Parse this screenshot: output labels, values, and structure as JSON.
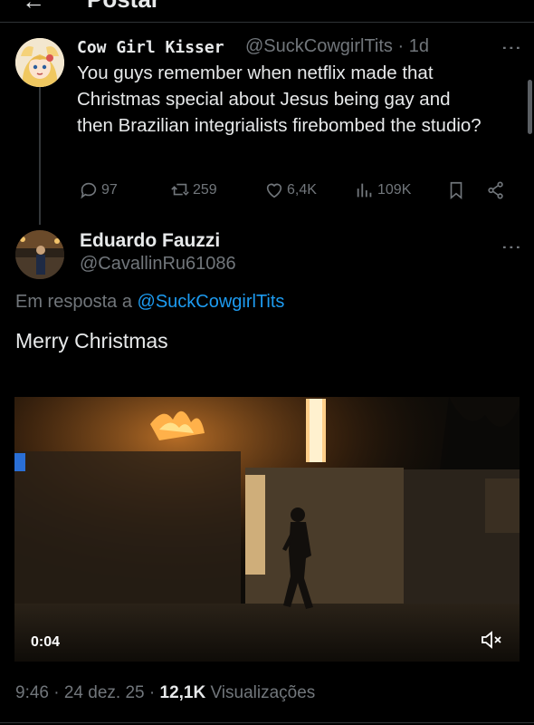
{
  "header": {
    "back_icon": "arrow-left-icon",
    "title": "Postar"
  },
  "original_post": {
    "display_name": "Cow Girl Kisser",
    "handle": "@SuckCowgirlTits",
    "age": "· 1d",
    "text": "You guys remember when netflix made that Christmas special about Jesus being gay and then Brazilian integrialists firebombed the studio?",
    "actions": {
      "replies": "97",
      "reposts": "259",
      "likes": "6,4K",
      "views": "109K"
    }
  },
  "reply_post": {
    "display_name": "Eduardo Fauzzi",
    "handle": "@CavallinRu61086",
    "reply_prefix": "Em resposta a ",
    "reply_to": "@SuckCowgirlTits",
    "text": "Merry Christmas",
    "video": {
      "elapsed": "0:04",
      "muted": true
    },
    "timestamp": "9:46 · 24 dez. 25 · ",
    "views_count": "12,1K",
    "views_label": " Visualizações"
  },
  "colors": {
    "background": "#000000",
    "text": "#e7e9ea",
    "muted": "#71767b",
    "link": "#1d9bf0"
  }
}
